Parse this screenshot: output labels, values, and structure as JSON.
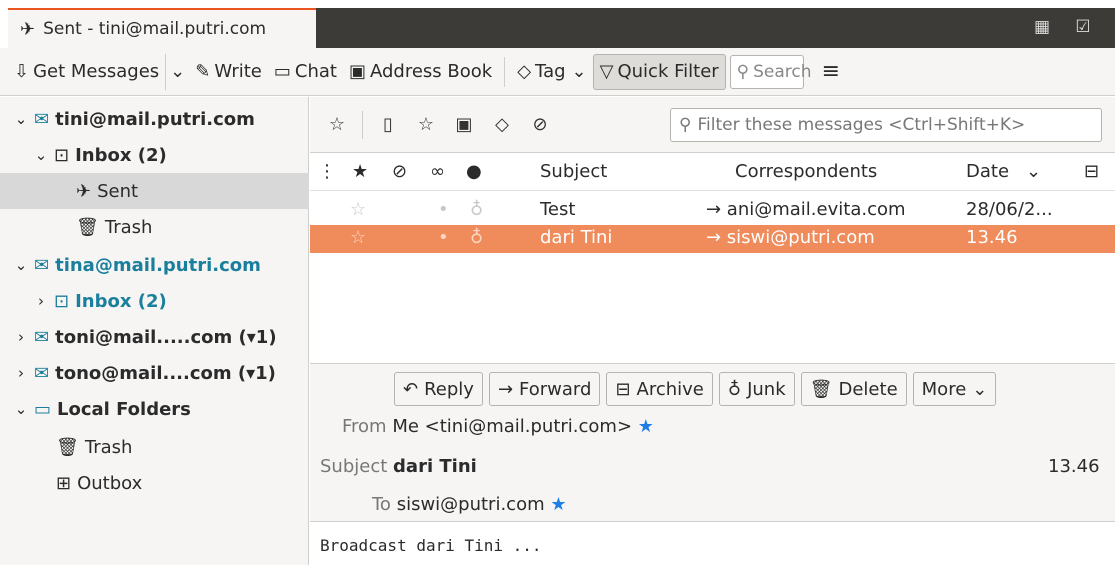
{
  "window": {
    "tab_title": "Sent - tini@mail.putri.com"
  },
  "toolbar": {
    "get_messages": "Get Messages",
    "write": "Write",
    "chat": "Chat",
    "address_book": "Address Book",
    "tag": "Tag",
    "quick_filter": "Quick Filter",
    "search_placeholder": "Search"
  },
  "folders": [
    {
      "label": "tini@mail.putri.com"
    },
    {
      "label": "Inbox (2)"
    },
    {
      "label": "Sent"
    },
    {
      "label": "Trash"
    },
    {
      "label": "tina@mail.putri.com"
    },
    {
      "label": "Inbox (2)"
    },
    {
      "label": "toni@mail.....com (▾1)"
    },
    {
      "label": "tono@mail....com (▾1)"
    },
    {
      "label": "Local Folders"
    },
    {
      "label": "Trash"
    },
    {
      "label": "Outbox"
    }
  ],
  "quickfilter": {
    "filter_placeholder": "Filter these messages <Ctrl+Shift+K>"
  },
  "columns": {
    "subject": "Subject",
    "correspondents": "Correspondents",
    "date": "Date"
  },
  "messages": [
    {
      "subject": "Test",
      "correspondent": "→ ani@mail.evita.com",
      "date": "28/06/2..."
    },
    {
      "subject": "dari Tini",
      "correspondent": "→ siswi@putri.com",
      "date": "13.46"
    }
  ],
  "header": {
    "reply": "Reply",
    "forward": "Forward",
    "archive": "Archive",
    "junk": "Junk",
    "delete": "Delete",
    "more": "More",
    "from_label": "From",
    "from_value": "Me <tini@mail.putri.com>",
    "subject_label": "Subject",
    "subject_value": "dari Tini",
    "time": "13.46",
    "to_label": "To",
    "to_value": "siswi@putri.com"
  },
  "body": {
    "text": "Broadcast dari Tini ..."
  },
  "colors": {
    "selection": "#f08c5c",
    "account_teal": "#1a7f9c",
    "star_blue": "#1e7ee8",
    "titlebar_dark": "#3c3b37"
  }
}
